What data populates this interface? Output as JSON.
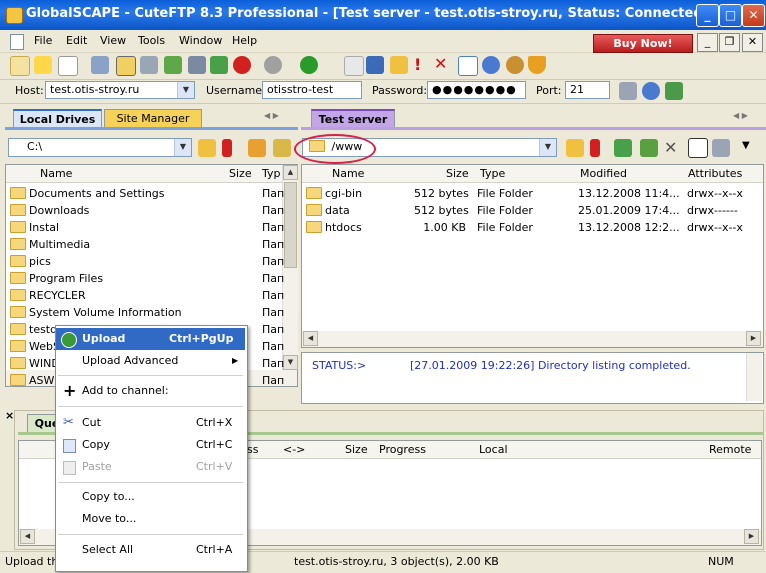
{
  "window": {
    "title": "GlobalSCAPE - CuteFTP 8.3 Professional - [Test server - test.otis-stroy.ru, Status: Connected]",
    "min": "_",
    "max": "□",
    "close": "✕"
  },
  "menu": {
    "items": [
      "File",
      "Edit",
      "View",
      "Tools",
      "Window",
      "Help"
    ],
    "buy_now": "Buy Now!",
    "doc_min": "_",
    "doc_restore": "❐",
    "doc_close": "✕"
  },
  "connection": {
    "host_label": "Host:",
    "host_value": "test.otis-stroy.ru",
    "username_label": "Username:",
    "username_value": "otisstro-test",
    "password_label": "Password:",
    "password_value": "●●●●●●●●",
    "port_label": "Port:",
    "port_value": "21"
  },
  "left_pane": {
    "tabs": [
      "Local Drives",
      "Site Manager"
    ],
    "path": "C:\\",
    "columns": [
      "Name",
      "Size",
      "Typ"
    ],
    "rows": [
      {
        "name": "Documents and Settings",
        "type": "Пап"
      },
      {
        "name": "Downloads",
        "type": "Пап"
      },
      {
        "name": "Instal",
        "type": "Пап"
      },
      {
        "name": "Multimedia",
        "type": "Пап"
      },
      {
        "name": "pics",
        "type": "Пап"
      },
      {
        "name": "Program Files",
        "type": "Пап"
      },
      {
        "name": "RECYCLER",
        "type": "Пап"
      },
      {
        "name": "System Volume Information",
        "type": "Пап"
      },
      {
        "name": "testd",
        "type": "Пап"
      },
      {
        "name": "WebS",
        "type": "Пап"
      },
      {
        "name": "WIND",
        "type": "Пап"
      },
      {
        "name": "ASWI",
        "type": "Пап"
      }
    ]
  },
  "right_pane": {
    "tab": "Test server",
    "path": "/www",
    "columns": [
      "Name",
      "Size",
      "Type",
      "Modified",
      "Attributes"
    ],
    "rows": [
      {
        "name": "cgi-bin",
        "size": "512 bytes",
        "type": "File Folder",
        "modified": "13.12.2008 11:4...",
        "attr": "drwx--x--x"
      },
      {
        "name": "data",
        "size": "512 bytes",
        "type": "File Folder",
        "modified": "25.01.2009 17:4...",
        "attr": "drwx------"
      },
      {
        "name": "htdocs",
        "size": "1.00 KB",
        "type": "File Folder",
        "modified": "13.12.2008 12:2...",
        "attr": "drwx--x--x"
      }
    ],
    "log": {
      "status_label": "STATUS:>",
      "message": "[27.01.2009 19:22:26] Directory listing completed."
    }
  },
  "queue": {
    "tab": "Que",
    "columns": [
      "ss",
      "<->",
      "Size",
      "Progress",
      "Local",
      "Remote"
    ]
  },
  "context_menu": {
    "items": [
      {
        "label": "Upload",
        "shortcut": "Ctrl+PgUp"
      },
      {
        "label": "Upload Advanced",
        "shortcut": ""
      },
      {
        "label": "Add to channel:",
        "shortcut": ""
      },
      {
        "label": "Cut",
        "shortcut": "Ctrl+X"
      },
      {
        "label": "Copy",
        "shortcut": "Ctrl+C"
      },
      {
        "label": "Paste",
        "shortcut": "Ctrl+V"
      },
      {
        "label": "Copy to...",
        "shortcut": ""
      },
      {
        "label": "Move to...",
        "shortcut": ""
      },
      {
        "label": "Select All",
        "shortcut": "Ctrl+A"
      }
    ]
  },
  "status_bar": {
    "left": "Upload the",
    "middle": "test.otis-stroy.ru, 3 object(s), 2.00 KB",
    "num": "NUM"
  }
}
